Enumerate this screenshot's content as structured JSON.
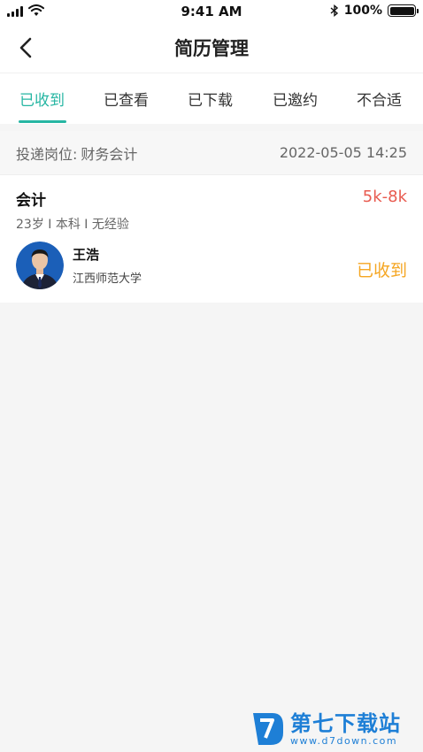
{
  "status_bar": {
    "time": "9:41 AM",
    "battery": "100%",
    "icons": [
      "signal-icon",
      "wifi-icon",
      "bluetooth-icon",
      "battery-icon"
    ]
  },
  "nav": {
    "title": "简历管理",
    "back_icon": "chevron-left-icon"
  },
  "tabs": [
    {
      "label": "已收到",
      "active": true
    },
    {
      "label": "已查看",
      "active": false
    },
    {
      "label": "已下载",
      "active": false
    },
    {
      "label": "已邀约",
      "active": false
    },
    {
      "label": "不合适",
      "active": false
    }
  ],
  "post": {
    "label": "投递岗位:",
    "position": "财务会计",
    "datetime": "2022-05-05 14:25"
  },
  "resume": {
    "title": "会计",
    "salary": "5k-8k",
    "meta": "23岁 I 本科 I 无经验",
    "name": "王浩",
    "school": "江西师范大学",
    "status": "已收到"
  },
  "watermark": {
    "text": "第七下载站",
    "url": "www.d7down.com"
  },
  "colors": {
    "accent": "#26b6a3",
    "salary": "#e85a4f",
    "status": "#f5a623",
    "watermark": "#1e7fd6"
  }
}
